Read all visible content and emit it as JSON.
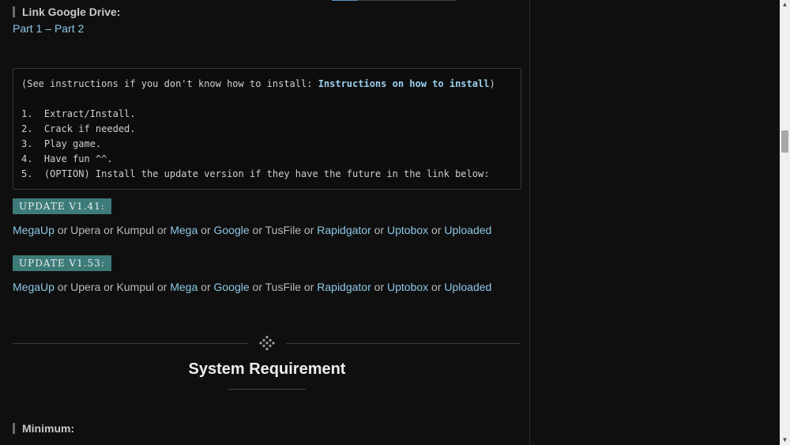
{
  "article": {
    "drive_heading": "Link Google Drive:",
    "parts": {
      "part1": "Part 1",
      "sep": " – ",
      "part2": "Part 2"
    },
    "instructions": {
      "prefix": "(See instructions if you don't know how to install: ",
      "link": "Instructions on how to install",
      "suffix": ")",
      "steps": [
        "1.  Extract/Install.",
        "2.  Crack if needed.",
        "3.  Play game.",
        "4.  Have fun ^^.",
        "5.  (OPTION) Install the update version if they have the future in the link below:"
      ]
    },
    "updates": [
      {
        "label": "UPDATE V1.41:"
      },
      {
        "label": "UPDATE V1.53:"
      }
    ],
    "mirrors": {
      "megaup": "MegaUp",
      "upera": "Upera",
      "kumpul": "Kumpul",
      "mega": "Mega",
      "google": "Google",
      "tusfile": "TusFile",
      "rapidgator": "Rapidgator",
      "uptobox": "Uptobox",
      "uploaded": "Uploaded",
      "or": " or "
    },
    "system_requirement_title": "System Requirement",
    "minimum_heading": "Minimum:"
  },
  "colors": {
    "background": "#0f0f0f",
    "link": "#8ec7e6",
    "badge": "#3d7b79",
    "text": "#b8b8b8"
  },
  "icons": {
    "divider": "diamond-dots-icon",
    "scroll_up": "scroll-up-arrow-icon",
    "scroll_down": "scroll-down-arrow-icon"
  }
}
